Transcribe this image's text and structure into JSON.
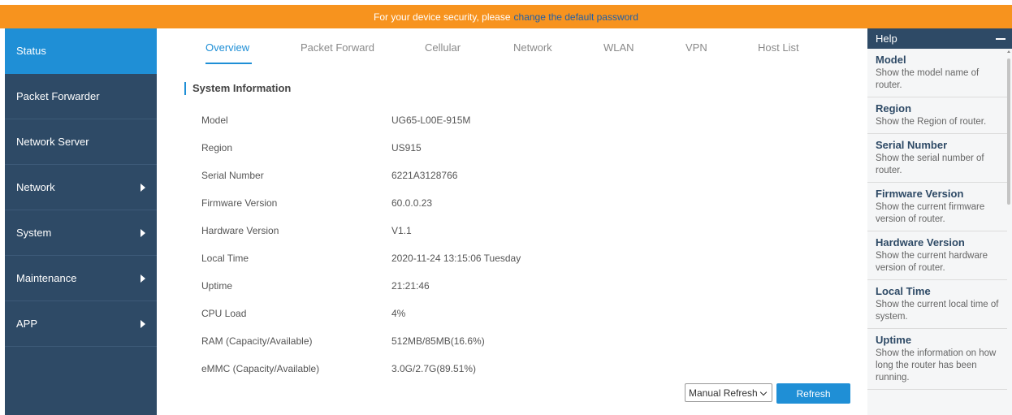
{
  "banner": {
    "text": "For your device security, please",
    "link": "change the default password"
  },
  "sidebar": {
    "items": [
      {
        "label": "Status",
        "active": true,
        "has_arrow": false
      },
      {
        "label": "Packet Forwarder",
        "active": false,
        "has_arrow": false
      },
      {
        "label": "Network Server",
        "active": false,
        "has_arrow": false
      },
      {
        "label": "Network",
        "active": false,
        "has_arrow": true
      },
      {
        "label": "System",
        "active": false,
        "has_arrow": true
      },
      {
        "label": "Maintenance",
        "active": false,
        "has_arrow": true
      },
      {
        "label": "APP",
        "active": false,
        "has_arrow": true
      }
    ]
  },
  "tabs": [
    {
      "label": "Overview",
      "active": true
    },
    {
      "label": "Packet Forward",
      "active": false
    },
    {
      "label": "Cellular",
      "active": false
    },
    {
      "label": "Network",
      "active": false
    },
    {
      "label": "WLAN",
      "active": false
    },
    {
      "label": "VPN",
      "active": false
    },
    {
      "label": "Host List",
      "active": false
    }
  ],
  "system_info": {
    "title": "System Information",
    "rows": [
      {
        "key": "Model",
        "value": "UG65-L00E-915M"
      },
      {
        "key": "Region",
        "value": "US915"
      },
      {
        "key": "Serial Number",
        "value": "6221A3128766"
      },
      {
        "key": "Firmware Version",
        "value": "60.0.0.23"
      },
      {
        "key": "Hardware Version",
        "value": "V1.1"
      },
      {
        "key": "Local Time",
        "value": "2020-11-24 13:15:06 Tuesday"
      },
      {
        "key": "Uptime",
        "value": "21:21:46"
      },
      {
        "key": "CPU Load",
        "value": "4%"
      },
      {
        "key": "RAM (Capacity/Available)",
        "value": "512MB/85MB(16.6%)"
      },
      {
        "key": "eMMC (Capacity/Available)",
        "value": "3.0G/2.7G(89.51%)"
      }
    ]
  },
  "refresh": {
    "select_value": "Manual Refresh",
    "button_label": "Refresh"
  },
  "help": {
    "title": "Help",
    "items": [
      {
        "title": "Model",
        "desc": "Show the model name of router."
      },
      {
        "title": "Region",
        "desc": "Show the Region of router."
      },
      {
        "title": "Serial Number",
        "desc": "Show the serial number of router."
      },
      {
        "title": "Firmware Version",
        "desc": "Show the current firmware version of router."
      },
      {
        "title": "Hardware Version",
        "desc": "Show the current hardware version of router."
      },
      {
        "title": "Local Time",
        "desc": "Show the current local time of system."
      },
      {
        "title": "Uptime",
        "desc": "Show the information on how long the router has been running."
      }
    ]
  },
  "colors": {
    "banner": "#f7931e",
    "sidebar": "#2e4a66",
    "accent": "#1f8fd6"
  }
}
